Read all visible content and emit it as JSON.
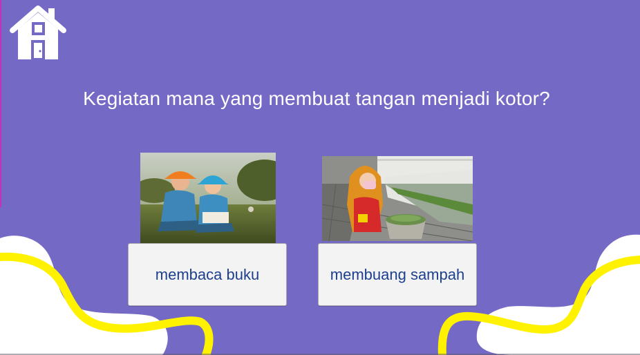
{
  "question": {
    "text": "Kegiatan mana yang membuat tangan menjadi kotor?"
  },
  "options": [
    {
      "label": "membaca buku",
      "image": "children-reading-book-photo"
    },
    {
      "label": "membuang sampah",
      "image": "girl-carrying-trash-bin-photo"
    }
  ],
  "home_button": {
    "icon": "home-icon"
  },
  "colors": {
    "background": "#7569c6",
    "accent": "#fff200",
    "text": "#ffffff",
    "option_text": "#1d3f8e"
  }
}
